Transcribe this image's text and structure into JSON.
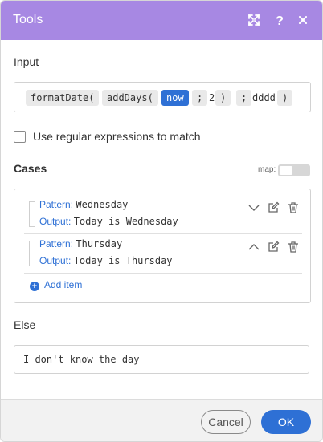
{
  "dialog": {
    "title": "Tools",
    "header_color": "#a788e3",
    "icons": [
      "expand-icon",
      "help-icon",
      "close-icon"
    ]
  },
  "input": {
    "label": "Input",
    "formula": {
      "fn1": "formatDate(",
      "fn2": "addDays(",
      "now": "now",
      "sep1": ";",
      "num": "2",
      "close1": ")",
      "sep2": ";",
      "fmt": "dddd",
      "close2": ")"
    }
  },
  "regex": {
    "label": "Use regular expressions to match",
    "checked": false
  },
  "cases": {
    "label": "Cases",
    "map_label": "map:",
    "map_enabled": false,
    "items": [
      {
        "pattern_key": "Pattern:",
        "pattern_value": "Wednesday",
        "output_key": "Output:",
        "output_value": "Today is Wednesday",
        "expand_icon": "chevron-down-icon"
      },
      {
        "pattern_key": "Pattern:",
        "pattern_value": "Thursday",
        "output_key": "Output:",
        "output_value": "Today is Thursday",
        "expand_icon": "chevron-up-icon"
      }
    ],
    "add_item": "Add item"
  },
  "else": {
    "label": "Else",
    "value": "I don't know the day"
  },
  "footer": {
    "cancel": "Cancel",
    "ok": "OK"
  },
  "colors": {
    "accent": "#2e70d5",
    "header": "#a788e3"
  }
}
